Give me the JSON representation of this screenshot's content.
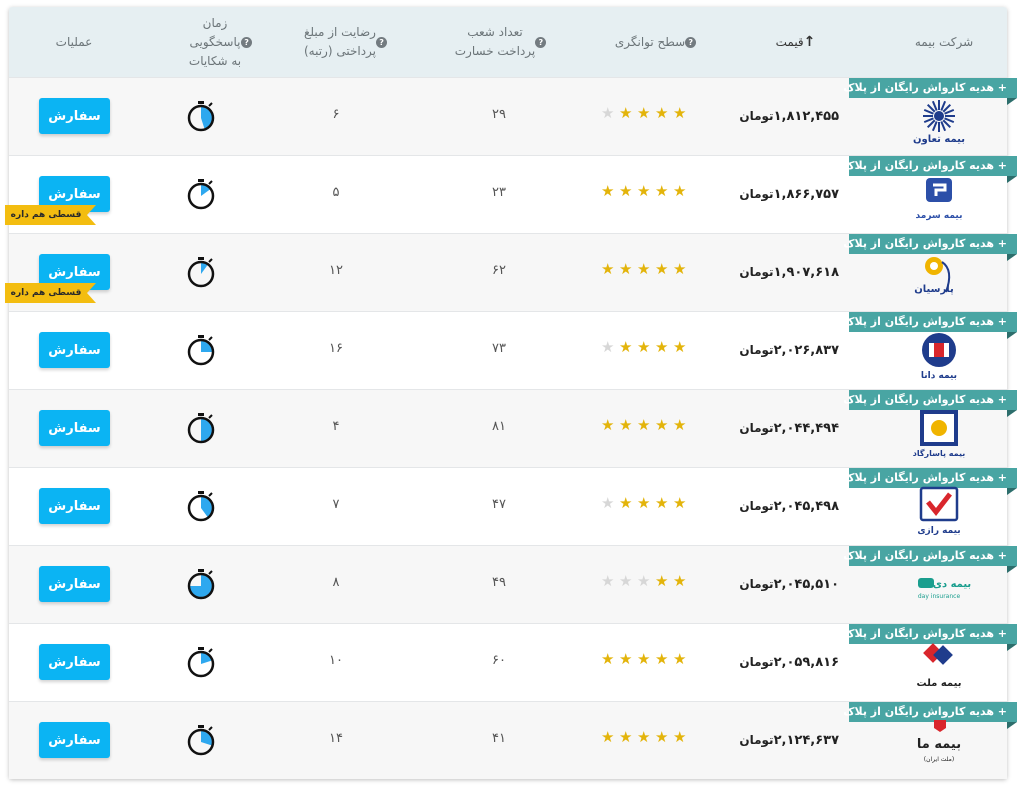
{
  "header": {
    "company": "شرکت بیمه",
    "price": "قیمت",
    "solvency": "سطح توانگری",
    "branches_line1": "تعداد شعب",
    "branches_line2": "پرداخت خسارت",
    "satisfaction_line1": "رضایت از مبلغ",
    "satisfaction_line2": "پرداختی (رتبه)",
    "response_line1": "زمان",
    "response_line2": "پاسخگویی",
    "response_line3": "به شکایات",
    "actions": "عملیات",
    "sort_icon": "arrow-up-icon",
    "help_icon": "question-circle-icon"
  },
  "gift_label": "+ هدیه کارواش رایگان از پلاک",
  "order_label": "سفارش",
  "installment_label": "قسطی هم داره",
  "currency": "تومان",
  "colors": {
    "accent": "#0bb4f3",
    "gift": "#49a5a3",
    "star": "#e3b40b",
    "badge": "#f3bd10"
  },
  "rows": [
    {
      "company": "بیمه تعاون",
      "logo": "taavon-logo",
      "price": "۱,۸۱۲,۴۵۵",
      "stars": 4,
      "branches": "۲۹",
      "satisfaction": "۶",
      "timer": 0.45
    },
    {
      "company": "بیمه سرمد",
      "logo": "sarmad-logo",
      "price": "۱,۸۶۶,۷۵۷",
      "stars": 5,
      "branches": "۲۳",
      "satisfaction": "۵",
      "timer": 0.15
    },
    {
      "company": "بیمه پارسیان",
      "logo": "parsian-logo",
      "price": "۱,۹۰۷,۶۱۸",
      "stars": 5,
      "branches": "۶۲",
      "satisfaction": "۱۲",
      "timer": 0.1
    },
    {
      "company": "بیمه دانا",
      "logo": "dana-logo",
      "price": "۲,۰۲۶,۸۳۷",
      "stars": 4,
      "branches": "۷۳",
      "satisfaction": "۱۶",
      "timer": 0.25
    },
    {
      "company": "بیمه پاسارگاد",
      "logo": "pasargad-logo",
      "price": "۲,۰۴۴,۴۹۴",
      "stars": 5,
      "branches": "۸۱",
      "satisfaction": "۴",
      "timer": 0.5
    },
    {
      "company": "بیمه رازی",
      "logo": "razi-logo",
      "price": "۲,۰۴۵,۴۹۸",
      "stars": 4,
      "branches": "۴۷",
      "satisfaction": "۷",
      "timer": 0.4
    },
    {
      "company": "بیمه دی",
      "logo": "day-logo",
      "price": "۲,۰۴۵,۵۱۰",
      "stars": 2,
      "branches": "۴۹",
      "satisfaction": "۸",
      "timer": 0.75
    },
    {
      "company": "بیمه ملت",
      "logo": "mellat-logo",
      "price": "۲,۰۵۹,۸۱۶",
      "stars": 5,
      "branches": "۶۰",
      "satisfaction": "۱۰",
      "timer": 0.2
    },
    {
      "company": "بیمه ما",
      "logo": "ma-logo",
      "price": "۲,۱۲۴,۶۳۷",
      "stars": 5,
      "branches": "۴۱",
      "satisfaction": "۱۴",
      "timer": 0.3
    }
  ],
  "logo_texts": {
    "taavon": "بیمه تعاون",
    "sarmad": "بیمه سرمد",
    "parsian": "پارسیان",
    "dana": "بیمه دانا",
    "pasargad": "بیمه پاسارگاد",
    "razi": "بیمه رازی",
    "day_fa": "بیمه دی",
    "day_en": "day insurance",
    "mellat": "بیمه ملت",
    "ma": "بیمه ما",
    "ma_sub": "(ملت ایران)"
  }
}
